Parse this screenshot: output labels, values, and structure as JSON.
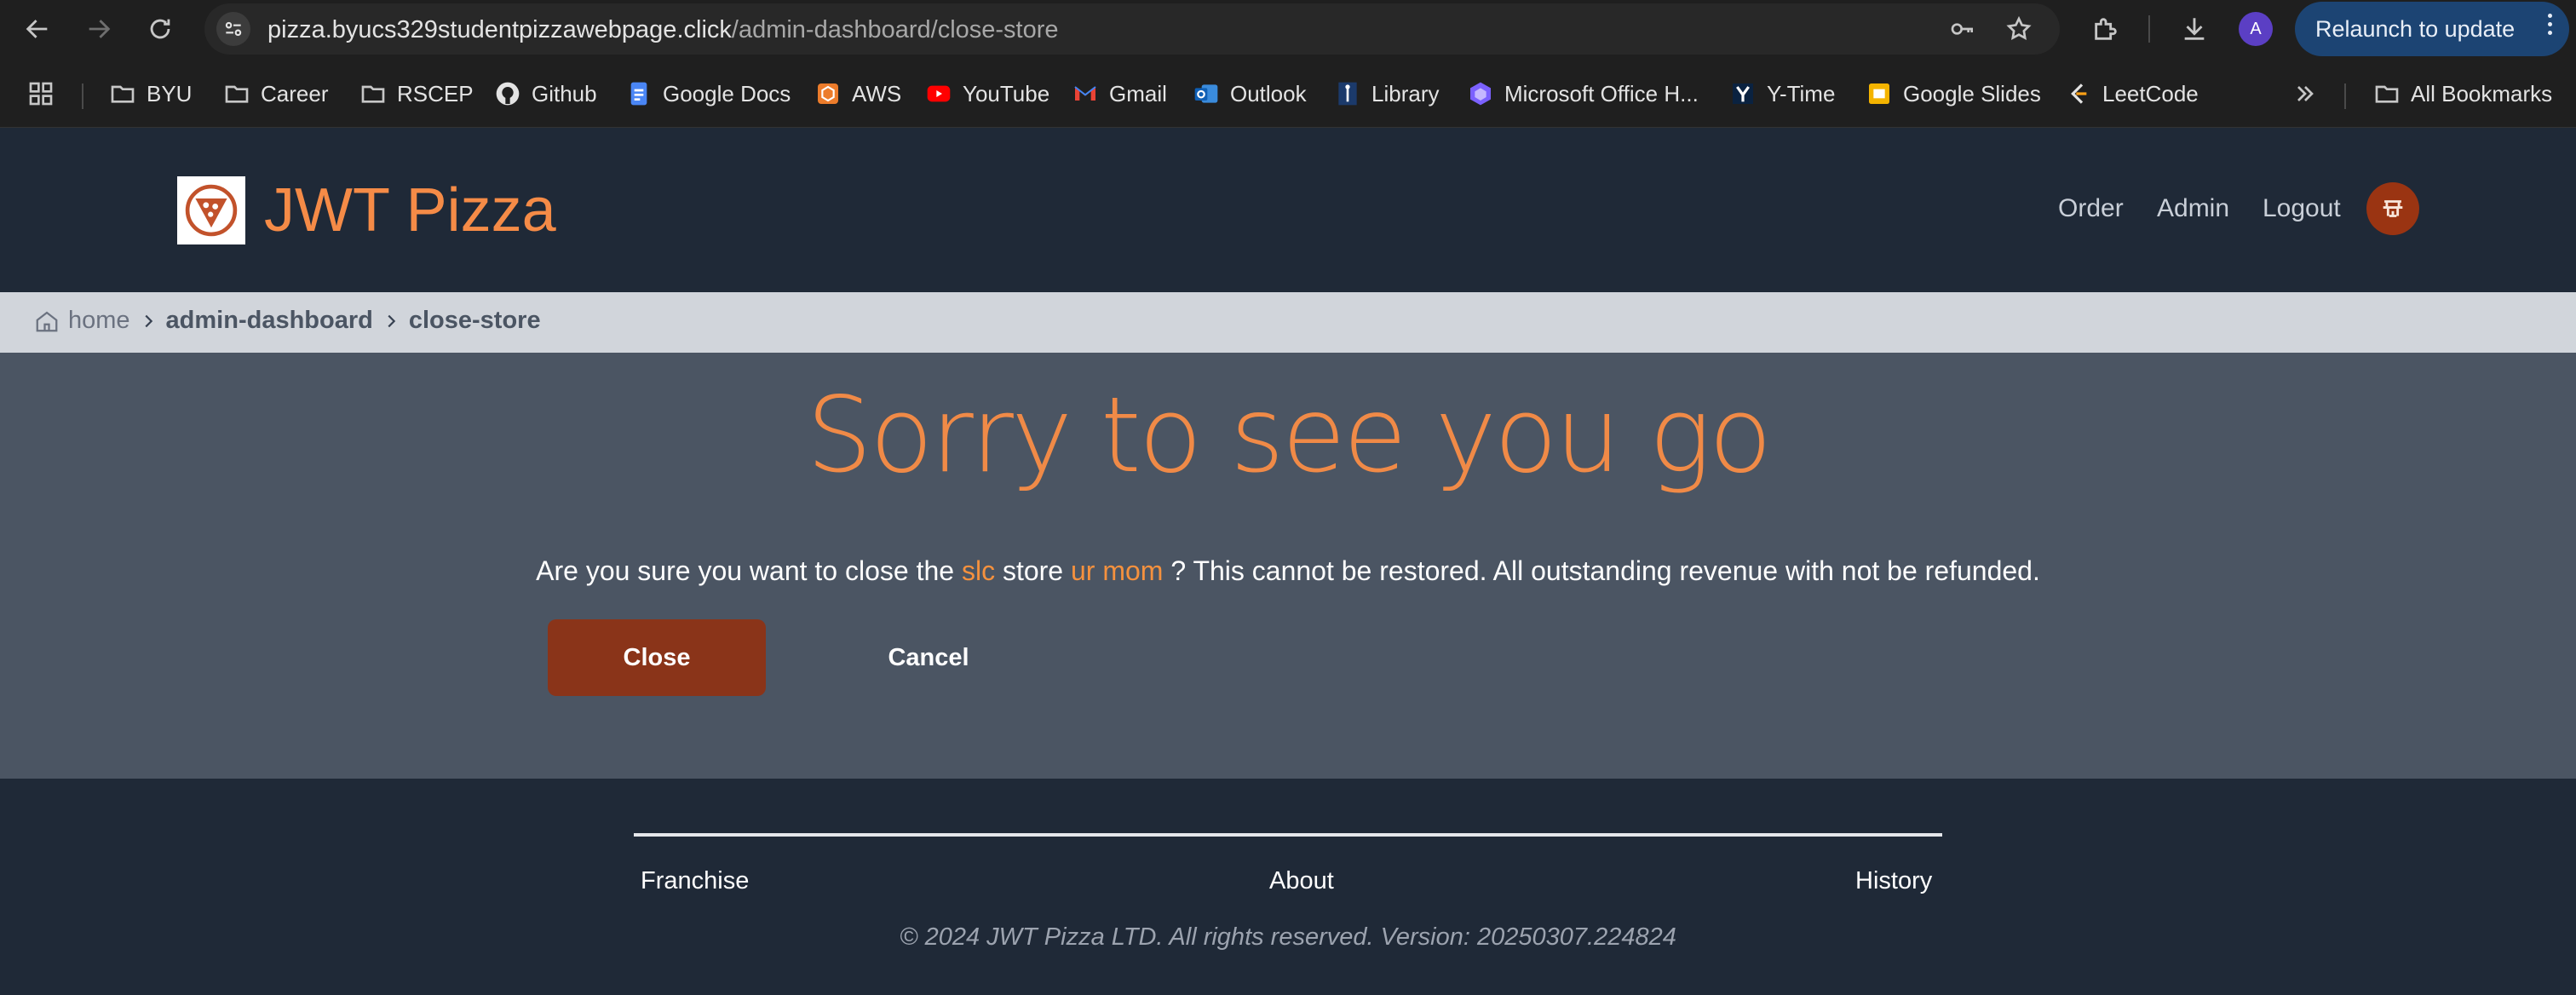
{
  "browser": {
    "url_host": "pizza.byucs329studentpizzawebpage.click",
    "url_path": "/admin-dashboard/close-store",
    "profile_initial": "A",
    "relaunch_label": "Relaunch to update"
  },
  "bookmarks": {
    "items": [
      "BYU",
      "Career",
      "RSCEP",
      "Github",
      "Google Docs",
      "AWS",
      "YouTube",
      "Gmail",
      "Outlook",
      "Library",
      "Microsoft Office H...",
      "Y-Time",
      "Google Slides",
      "LeetCode"
    ],
    "all_label": "All Bookmarks"
  },
  "header": {
    "brand": "JWT Pizza",
    "nav": [
      "Order",
      "Admin",
      "Logout"
    ]
  },
  "breadcrumb": {
    "home": "home",
    "items": [
      "admin-dashboard",
      "close-store"
    ]
  },
  "main": {
    "title": "Sorry to see you go",
    "confirm_prefix": "Are you sure you want to close the",
    "franchise": "slc",
    "confirm_mid": "store",
    "store": "ur mom",
    "confirm_suffix": "? This cannot be restored. All outstanding revenue with not be refunded.",
    "close_label": "Close",
    "cancel_label": "Cancel"
  },
  "footer": {
    "links": [
      "Franchise",
      "About",
      "History"
    ],
    "copyright": "© 2024 JWT Pizza LTD. All rights reserved. Version: 20250307.224824"
  },
  "colors": {
    "brand_orange": "#f58b47",
    "close_button": "#8a3419",
    "header_bg": "#1f2937",
    "main_bg": "#4b5563",
    "relaunch_bg": "#1c4473"
  }
}
